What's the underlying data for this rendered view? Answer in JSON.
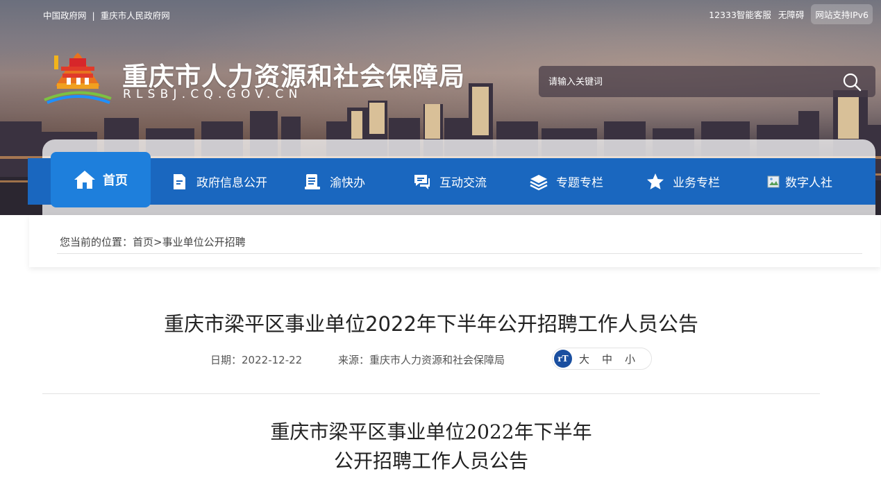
{
  "topbar": {
    "left_links": [
      "中国政府网",
      "重庆市人民政府网"
    ],
    "separator": "|",
    "right_links": [
      "12333智能客服",
      "无障碍"
    ],
    "ipv6": "网站支持IPv6"
  },
  "header": {
    "title": "重庆市人力资源和社会保障局",
    "domain": "RLSBJ.CQ.GOV.CN"
  },
  "search": {
    "placeholder": "请输入关键词"
  },
  "nav": {
    "home": "首页",
    "items": [
      {
        "label": "政府信息公开",
        "icon": "document-icon"
      },
      {
        "label": "渝快办",
        "icon": "book-icon"
      },
      {
        "label": "互动交流",
        "icon": "chat-icon"
      },
      {
        "label": "专题专栏",
        "icon": "layers-icon"
      },
      {
        "label": "业务专栏",
        "icon": "star-icon"
      },
      {
        "label": "数字人社",
        "icon": "broken-image-icon"
      }
    ]
  },
  "breadcrumb": {
    "prefix": "您当前的位置：",
    "home": "首页",
    "sep": ">",
    "current": "事业单位公开招聘"
  },
  "article": {
    "title": "重庆市梁平区事业单位2022年下半年公开招聘工作人员公告",
    "date_label": "日期：",
    "date": "2022-12-22",
    "source_label": "来源：",
    "source": "重庆市人力资源和社会保障局",
    "font_icon": "rT",
    "font_sizes": [
      "大",
      "中",
      "小"
    ],
    "body_title_line1": "重庆市梁平区事业单位2022年下半年",
    "body_title_line2": "公开招聘工作人员公告"
  },
  "colors": {
    "nav_blue": "#1a67bf",
    "nav_active": "#1e7fdc"
  }
}
